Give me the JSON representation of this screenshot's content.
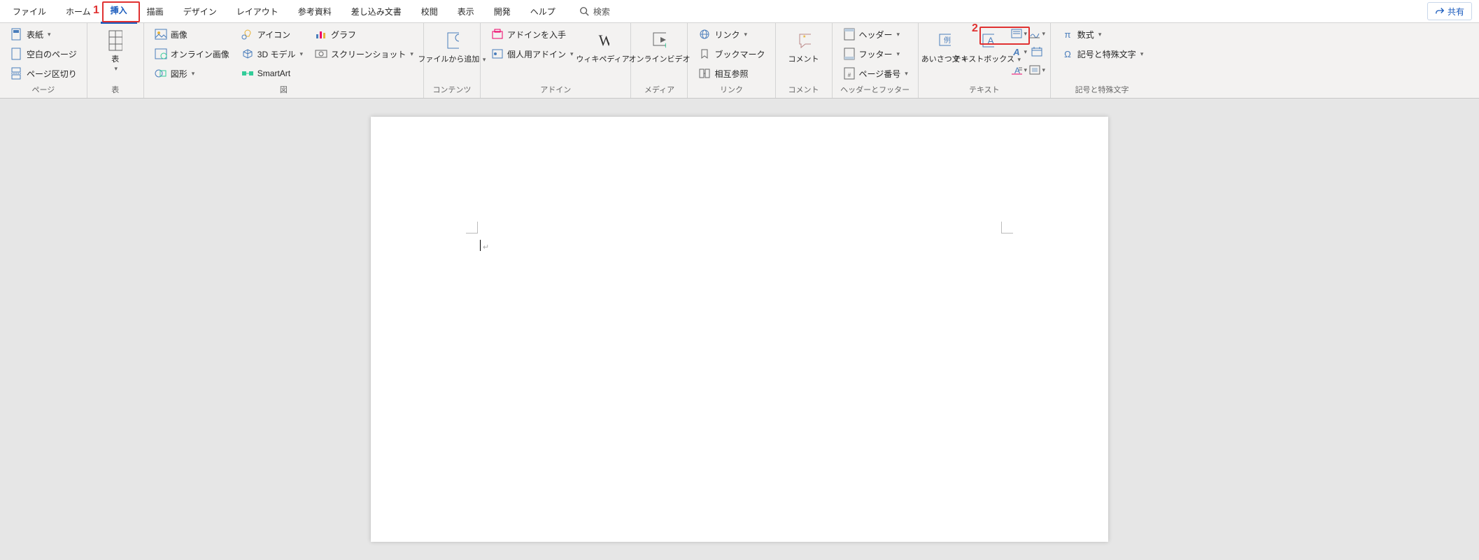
{
  "tabs": {
    "file": "ファイル",
    "home": "ホーム",
    "insert": "挿入",
    "draw": "描画",
    "design": "デザイン",
    "layout": "レイアウト",
    "references": "参考資料",
    "mailings": "差し込み文書",
    "review": "校閲",
    "view": "表示",
    "developer": "開発",
    "help": "ヘルプ"
  },
  "search": {
    "label": "検索"
  },
  "share": {
    "label": "共有"
  },
  "groups": {
    "pages": {
      "label": "ページ",
      "cover": "表紙",
      "blank": "空白のページ",
      "break": "ページ区切り"
    },
    "tables": {
      "label": "表",
      "table": "表"
    },
    "illustrations": {
      "label": "図",
      "pictures": "画像",
      "online_pictures": "オンライン画像",
      "shapes": "図形",
      "icons": "アイコン",
      "model3d": "3D モデル",
      "smartart": "SmartArt",
      "chart": "グラフ",
      "screenshot": "スクリーンショット"
    },
    "content": {
      "label": "コンテンツ",
      "reuse_files": "ファイルから追加"
    },
    "addins": {
      "label": "アドイン",
      "get": "アドインを入手",
      "my": "個人用アドイン",
      "wikipedia": "ウィキペディア"
    },
    "media": {
      "label": "メディア",
      "online_video": "オンラインビデオ"
    },
    "links": {
      "label": "リンク",
      "link": "リンク",
      "bookmark": "ブックマーク",
      "crossref": "相互参照"
    },
    "comments": {
      "label": "コメント",
      "comment": "コメント"
    },
    "headerfooter": {
      "label": "ヘッダーとフッター",
      "header": "ヘッダー",
      "footer": "フッター",
      "pagenum": "ページ番号"
    },
    "text": {
      "label": "テキスト",
      "greeting": "あいさつ文",
      "textbox": "テキストボックス"
    },
    "symbols": {
      "label": "記号と特殊文字",
      "equation": "数式",
      "symbol": "記号と特殊文字"
    }
  },
  "annotations": {
    "one": "1",
    "two": "2"
  }
}
